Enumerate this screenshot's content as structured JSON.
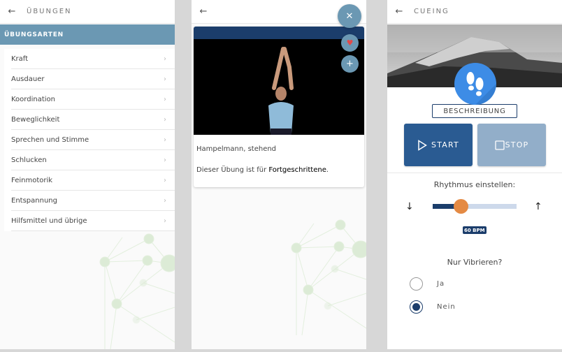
{
  "screens": [
    {
      "header": {
        "title": "ÜBUNGEN",
        "back_icon": "arrow-left"
      },
      "section_title": "ÜBUNGSARTEN",
      "categories": [
        {
          "label": "Kraft"
        },
        {
          "label": "Ausdauer"
        },
        {
          "label": "Koordination"
        },
        {
          "label": "Beweglichkeit"
        },
        {
          "label": "Sprechen und Stimme"
        },
        {
          "label": "Schlucken"
        },
        {
          "label": "Feinmotorik"
        },
        {
          "label": "Entspannung"
        },
        {
          "label": "Hilfsmittel und übrige"
        }
      ],
      "chevron": "›"
    },
    {
      "header": {
        "back_icon": "arrow-left"
      },
      "fab": {
        "close": "✕",
        "favorite": "♥",
        "add": "+"
      },
      "exercise": {
        "title": "Hampelmann, stehend",
        "desc_prefix": "Dieser Übung ist für ",
        "level": "Fortgeschrittene",
        "desc_suffix": "."
      },
      "colors": {
        "heart": "#e24a4a",
        "fab": "#6b98b3"
      }
    },
    {
      "header": {
        "title": "CUEING",
        "back_icon": "arrow-left"
      },
      "description_button": "BESCHREIBUNG",
      "start_label": "START",
      "stop_label": "STOP",
      "rhythm_label": "Rhythmus einstellen:",
      "rhythm_down": "↓",
      "rhythm_up": "↑",
      "rhythm_value": 0.33,
      "bpm_label": "60 BPM",
      "vibrate_label": "Nur Vibrieren?",
      "options": [
        {
          "label": "Ja",
          "selected": false
        },
        {
          "label": "Nein",
          "selected": true
        }
      ],
      "colors": {
        "primary": "#2a5b92",
        "stop": "#92aec9",
        "thumb": "#e48a44",
        "feet_bg": "#3d8ce6"
      }
    }
  ]
}
